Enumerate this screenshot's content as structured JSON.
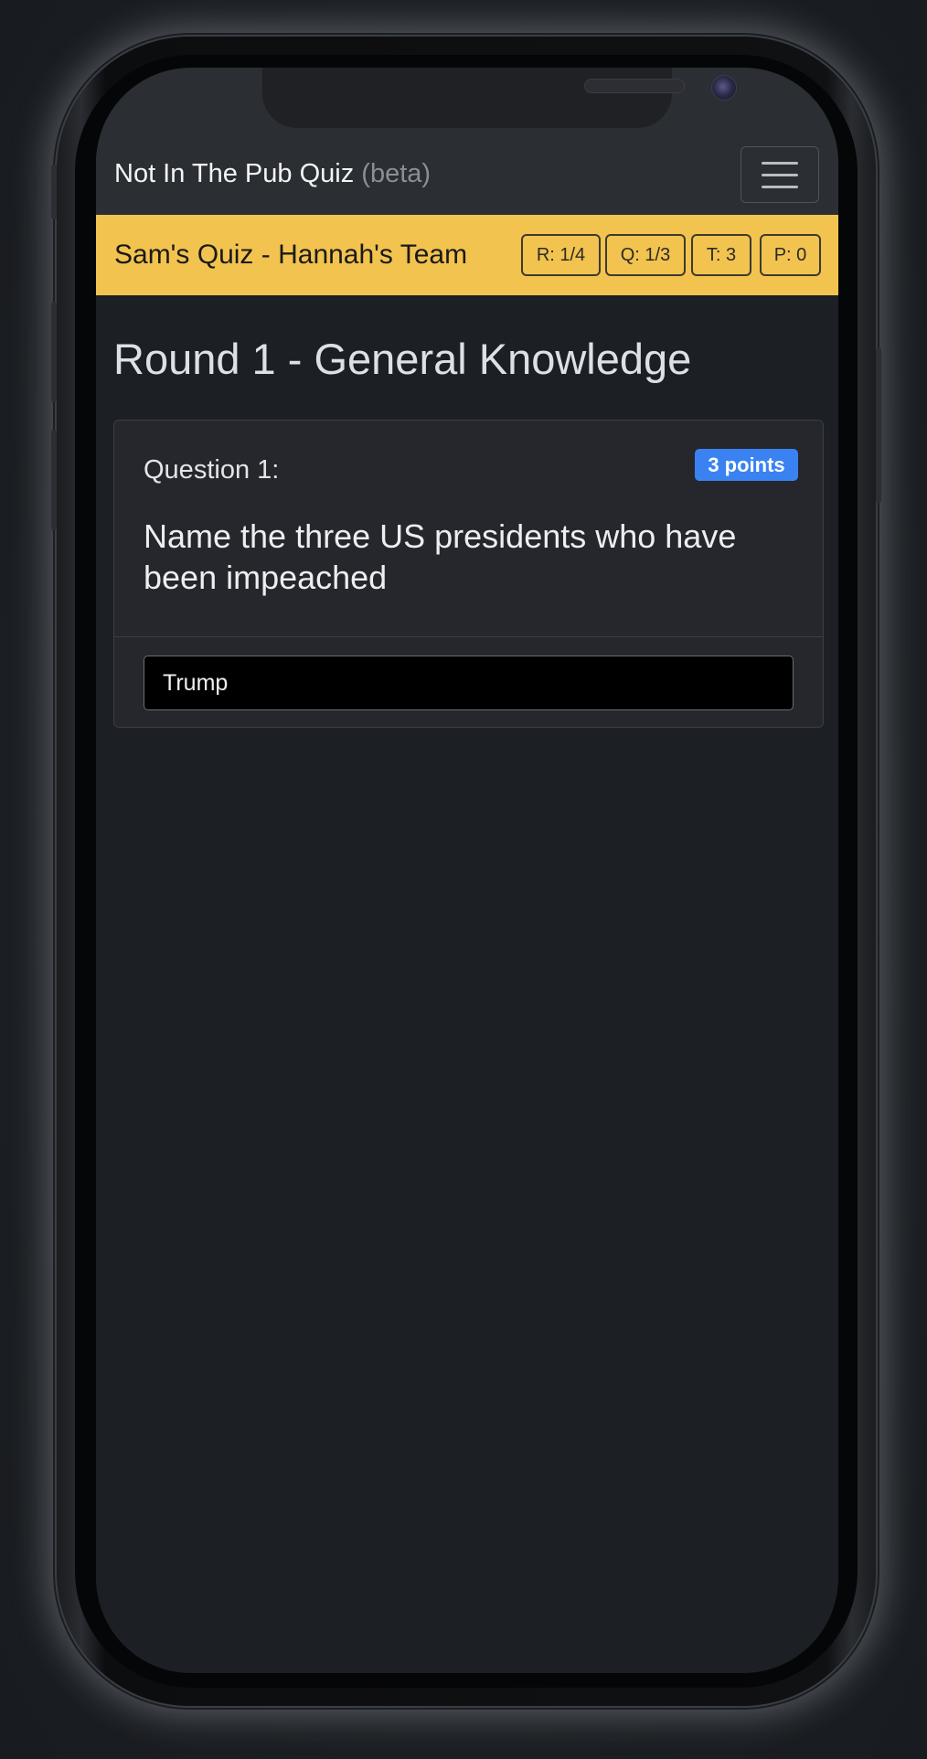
{
  "navbar": {
    "brand": "Not In The Pub Quiz",
    "brand_suffix": "(beta)",
    "menu_icon": "hamburger-menu-icon"
  },
  "quiz_bar": {
    "title": "Sam's Quiz - Hannah's Team",
    "color": "#f2c34f",
    "stats": {
      "round": "R: 1/4",
      "question": "Q: 1/3",
      "team": "T: 3",
      "points": "P: 0"
    }
  },
  "main": {
    "round_title": "Round 1 - General Knowledge",
    "question": {
      "label": "Question 1:",
      "points_badge": "3 points",
      "badge_color": "#3a82f2",
      "text": "Name the three US presidents who have been impeached",
      "answer_value": "Trump"
    }
  }
}
